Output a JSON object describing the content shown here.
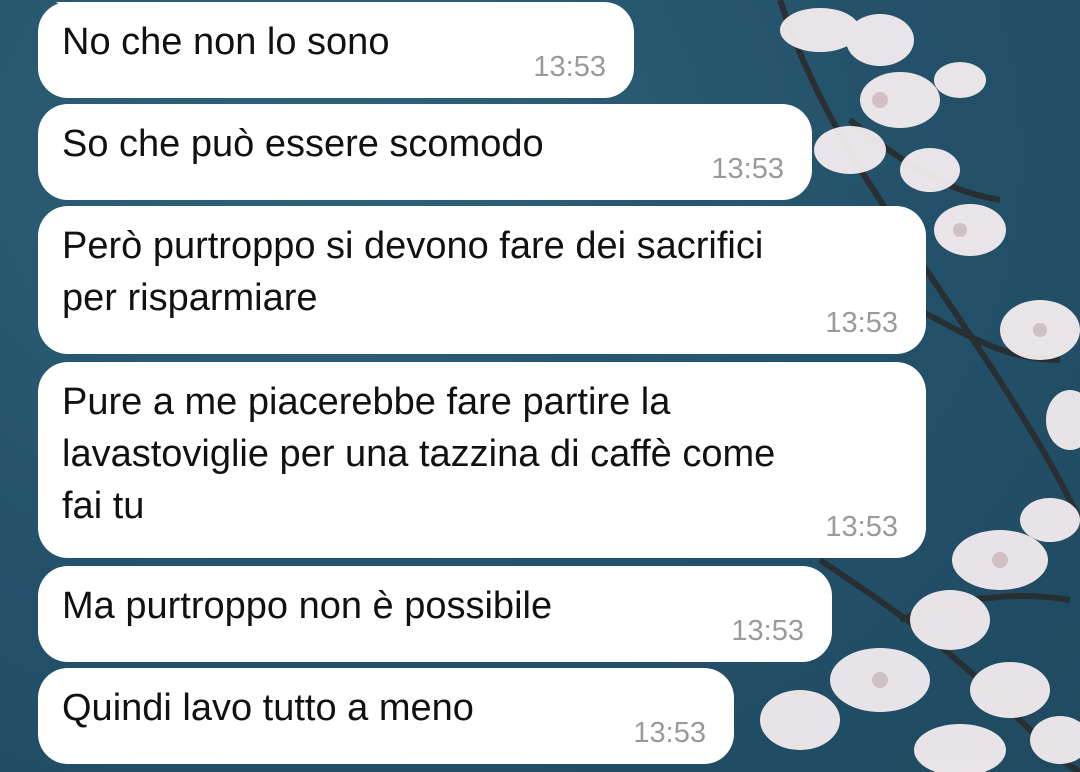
{
  "messages": [
    {
      "text": "No che non lo sono",
      "time": "13:53"
    },
    {
      "text": "So che può essere scomodo",
      "time": "13:53"
    },
    {
      "text": "Però purtroppo si devono fare dei sacrifici\nper risparmiare",
      "time": "13:53"
    },
    {
      "text": "Pure a me piacerebbe fare partire la\nlavastoviglie per una tazzina di caffè come\nfai tu",
      "time": "13:53"
    },
    {
      "text": "Ma purtroppo non è possibile",
      "time": "13:53"
    },
    {
      "text": "Quindi lavo tutto a meno",
      "time": "13:53"
    }
  ],
  "colors": {
    "wallpaper": "#27566a",
    "bubble": "#ffffff",
    "text": "#111111",
    "timestamp": "#9a9a9a"
  }
}
